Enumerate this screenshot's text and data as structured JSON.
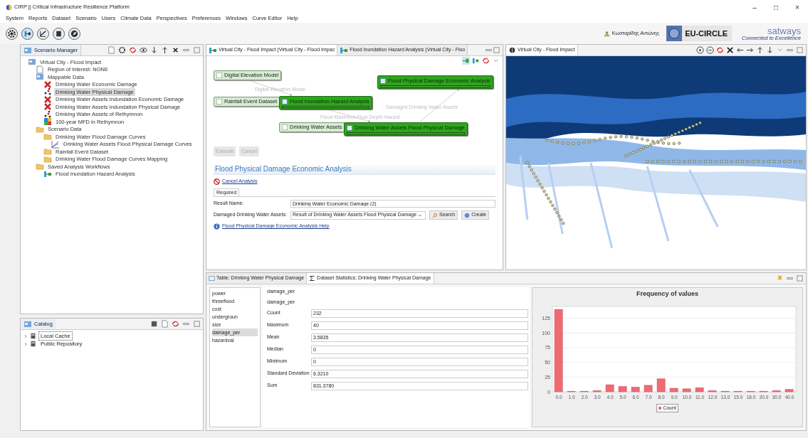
{
  "window": {
    "title": "CIRP || Critical Infrastructure Resilience Platform",
    "controls": [
      "–",
      "□",
      "×"
    ]
  },
  "menu": [
    "System",
    "Reports",
    "Dataset",
    "Scenario",
    "Users",
    "Climate Data",
    "Perspectives",
    "Preferences",
    "Windows",
    "Curve Editor",
    "Help"
  ],
  "toolbar": {
    "user": "Κωσταρίδης Αντώνης",
    "partner": "EU-CIRCLE",
    "brand": "satways",
    "brand_tagline": "Connected to Excellence"
  },
  "scenario_manager": {
    "title": "Scenario Manager",
    "tree": [
      {
        "label": "Virtual City - Flood Impact",
        "kind": "map",
        "selected": false,
        "children": [
          {
            "label": "Region of Interest: NONE",
            "kind": "document",
            "selected": false
          },
          {
            "label": "Mappable Data",
            "kind": "map",
            "selected": false,
            "children": [
              {
                "label": "Drinking Water Economic Damage",
                "kind": "damage",
                "selected": false
              },
              {
                "label": "Drinking Water Physical Damage",
                "kind": "points",
                "selected": true
              },
              {
                "label": "Drinking Water Assets Indundation Economic Damage",
                "kind": "damage",
                "selected": false
              },
              {
                "label": "Drinking Water Assets Indundation Physical Damage",
                "kind": "damage",
                "selected": false
              },
              {
                "label": "Drinking Water Assets of Rethymnon",
                "kind": "points",
                "selected": false
              },
              {
                "label": "100-year MFD in Rethymnon",
                "kind": "raster",
                "selected": false
              }
            ]
          },
          {
            "label": "Scenario Data",
            "kind": "folder",
            "selected": false,
            "children": [
              {
                "label": "Drinking Water Flood Damage Curves",
                "kind": "folder",
                "selected": false,
                "children": [
                  {
                    "label": "Drinking Water Assets Flood Physical Damage Curves",
                    "kind": "curve",
                    "selected": false
                  }
                ]
              },
              {
                "label": "Rainfall Event Dataset",
                "kind": "folder",
                "selected": false
              },
              {
                "label": "Drinking Water Flood Damage Curves Mapping",
                "kind": "folder",
                "selected": false
              }
            ]
          },
          {
            "label": "Saved Analysis Workflows",
            "kind": "folder",
            "selected": false,
            "children": [
              {
                "label": "Flood Inundation Hazard Analysis",
                "kind": "workflow",
                "selected": false
              }
            ]
          }
        ]
      }
    ]
  },
  "catalog": {
    "title": "Catalog",
    "items": [
      {
        "label": "Local Cache",
        "selected": true
      },
      {
        "label": "Public Repository",
        "selected": false
      }
    ]
  },
  "workflow_editor": {
    "tabs": [
      {
        "label": "Virtual City - Flood Impact (Virtual City - Flood Impac",
        "selected": true
      },
      {
        "label": "Flood Inundation Hazard Analysis (Virtual City - Floo",
        "selected": false
      }
    ],
    "nodes": [
      {
        "label": "Digital Elevation Model",
        "kind": "input"
      },
      {
        "label": "Rainfall Event Dataset",
        "kind": "input"
      },
      {
        "label": "Flood Inundation Hazard Analysis",
        "kind": "process",
        "level": 1
      },
      {
        "label": "Flood Physical Damage Economic Analysis",
        "kind": "process",
        "level": 1
      },
      {
        "label": "Drinking Water Assets",
        "kind": "input"
      },
      {
        "label": "Drinking Water Assets Flood Physical Damage",
        "kind": "process",
        "level": 1
      }
    ],
    "edge_labels": [
      "Digital Elevation Model",
      "Flood Maximum Flow Depth Hazard",
      "Damaged Drinking Water Assets"
    ],
    "buttons": [
      {
        "label": "Execute",
        "disabled": true
      },
      {
        "label": "Cancel",
        "disabled": true
      }
    ],
    "form": {
      "heading": "Flood Physical Damage Economic Analysis",
      "cancel_link": "Cancel Analysis",
      "tab": "Required",
      "result_name": {
        "label": "Result Name:",
        "value": "Drinking Water Economic Damage (2)"
      },
      "assets": {
        "label": "Damaged Drinking Water Assets:",
        "value": "Result of Drinking Water Assets Flood Physical Damage"
      },
      "search_button": "Search",
      "create_button": "Create",
      "help_link": "Flood Physical Damage Economic Analysis Help"
    }
  },
  "map_view": {
    "title": "Virtual City - Flood Impact"
  },
  "statistics": {
    "tabs": [
      {
        "label": "Table: Drinking Water Physical Damage",
        "selected": false
      },
      {
        "label": "Dataset Statistics: Drinking Water Physical Damage",
        "selected": true
      }
    ],
    "columns": [
      {
        "label": "power",
        "selected": false
      },
      {
        "label": "threeflood",
        "selected": false
      },
      {
        "label": "cost",
        "selected": false
      },
      {
        "label": "undergroun",
        "selected": false
      },
      {
        "label": "size",
        "selected": false
      },
      {
        "label": "damage_per",
        "selected": true
      },
      {
        "label": "hazardval",
        "selected": false
      }
    ],
    "headers": [
      "damage_per",
      "damage_per"
    ],
    "rows": [
      {
        "label": "Count",
        "value": "232"
      },
      {
        "label": "Maximum",
        "value": "40"
      },
      {
        "label": "Mean",
        "value": "3.5835"
      },
      {
        "label": "Median",
        "value": "0"
      },
      {
        "label": "Minimum",
        "value": "0"
      },
      {
        "label": "Standard Deviation",
        "value": "6.3210"
      },
      {
        "label": "Sum",
        "value": "831.3780"
      }
    ],
    "chart_data": {
      "type": "bar",
      "title": "Frequency of values",
      "categories": [
        "0.0",
        "1.0",
        "2.0",
        "3.0",
        "4.0",
        "5.0",
        "6.0",
        "7.0",
        "8.0",
        "9.0",
        "10.0",
        "11.0",
        "12.0",
        "13.0",
        "15.0",
        "18.0",
        "20.0",
        "30.0",
        "40.0"
      ],
      "series": [
        {
          "name": "Count",
          "color": "#f06a74",
          "values": [
            140,
            1,
            1,
            2,
            12,
            9,
            8,
            11,
            22,
            6,
            5,
            7,
            2,
            1,
            1,
            1,
            1,
            2,
            4
          ]
        }
      ],
      "ylim": [
        0,
        145
      ],
      "yticks": [
        0,
        25,
        50,
        75,
        100,
        125
      ],
      "grid": true
    }
  }
}
